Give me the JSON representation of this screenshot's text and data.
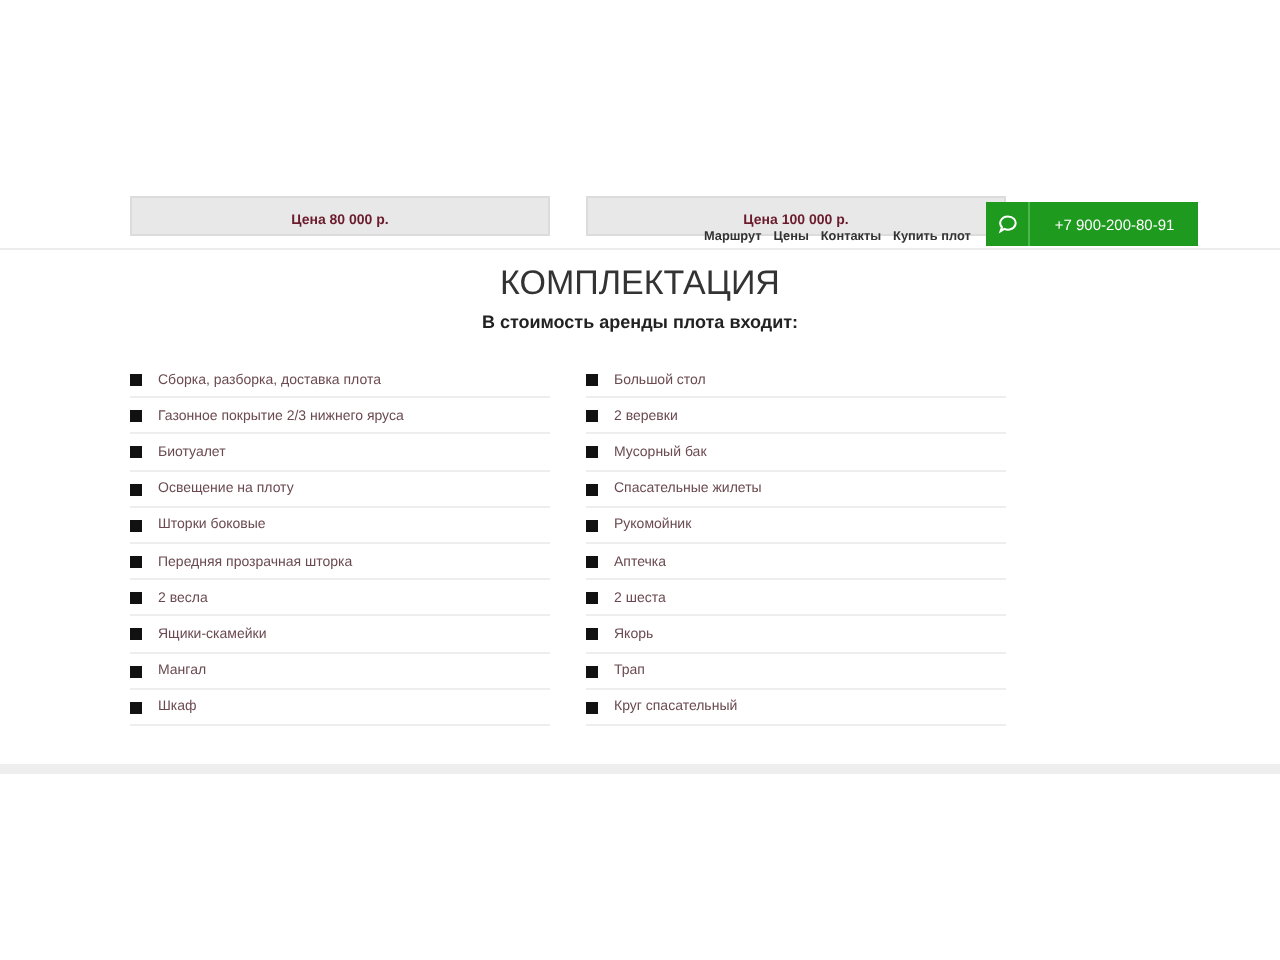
{
  "prices": [
    {
      "text": "Цена 80 000 р."
    },
    {
      "text": "Цена 100 000 р."
    }
  ],
  "nav": {
    "links": [
      "Маршрут",
      "Цены",
      "Контакты",
      "Купить плот"
    ],
    "phone": "+7 900-200-80-91"
  },
  "section": {
    "title": "КОМПЛЕКТАЦИЯ",
    "subtitle": "В стоимость аренды плота входит:",
    "columns": [
      [
        "Сборка, разборка, доставка плота",
        "Газонное покрытие 2/3 нижнего яруса",
        "Биотуалет",
        "Освещение на плоту",
        "Шторки боковые",
        "Передняя прозрачная шторка",
        "2 весла",
        "Ящики-скамейки",
        "Мангал",
        "Шкаф"
      ],
      [
        "Большой стол",
        "2 веревки",
        "Мусорный бак",
        "Спасательные жилеты",
        "Рукомойник",
        "Аптечка",
        "2 шеста",
        "Якорь",
        "Трап",
        "Круг спасательный"
      ]
    ]
  }
}
